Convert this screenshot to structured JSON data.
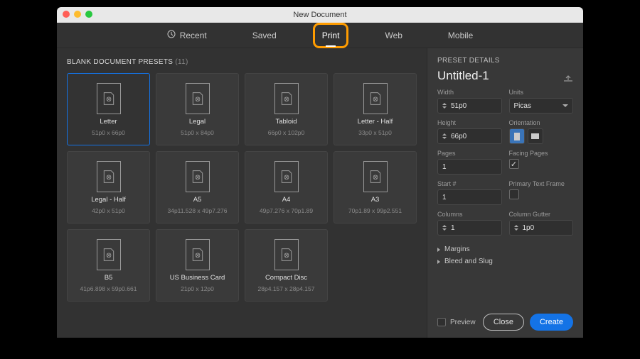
{
  "window_title": "New Document",
  "tabs": [
    {
      "label": "Recent",
      "icon": "clock-icon"
    },
    {
      "label": "Saved"
    },
    {
      "label": "Print",
      "active": true,
      "highlight": true
    },
    {
      "label": "Web"
    },
    {
      "label": "Mobile"
    }
  ],
  "presets_section": {
    "label": "BLANK DOCUMENT PRESETS",
    "count": "(11)"
  },
  "presets": [
    {
      "name": "Letter",
      "dims": "51p0 x 66p0",
      "selected": true
    },
    {
      "name": "Legal",
      "dims": "51p0 x 84p0"
    },
    {
      "name": "Tabloid",
      "dims": "66p0 x 102p0"
    },
    {
      "name": "Letter - Half",
      "dims": "33p0 x 51p0"
    },
    {
      "name": "Legal - Half",
      "dims": "42p0 x 51p0"
    },
    {
      "name": "A5",
      "dims": "34p11.528 x 49p7.276"
    },
    {
      "name": "A4",
      "dims": "49p7.276 x 70p1.89"
    },
    {
      "name": "A3",
      "dims": "70p1.89 x 99p2.551"
    },
    {
      "name": "B5",
      "dims": "41p6.898 x 59p0.661"
    },
    {
      "name": "US Business Card",
      "dims": "21p0 x 12p0"
    },
    {
      "name": "Compact Disc",
      "dims": "28p4.157 x 28p4.157"
    }
  ],
  "details": {
    "heading": "PRESET DETAILS",
    "document_name": "Untitled-1",
    "width_label": "Width",
    "width": "51p0",
    "units_label": "Units",
    "units": "Picas",
    "height_label": "Height",
    "height": "66p0",
    "orientation_label": "Orientation",
    "orientation": "portrait",
    "pages_label": "Pages",
    "pages": "1",
    "facing_label": "Facing Pages",
    "facing_checked": true,
    "start_label": "Start #",
    "start": "1",
    "primary_label": "Primary Text Frame",
    "primary_checked": false,
    "columns_label": "Columns",
    "columns": "1",
    "gutter_label": "Column Gutter",
    "gutter": "1p0",
    "margins_label": "Margins",
    "bleed_label": "Bleed and Slug",
    "preview_label": "Preview",
    "close_label": "Close",
    "create_label": "Create"
  }
}
